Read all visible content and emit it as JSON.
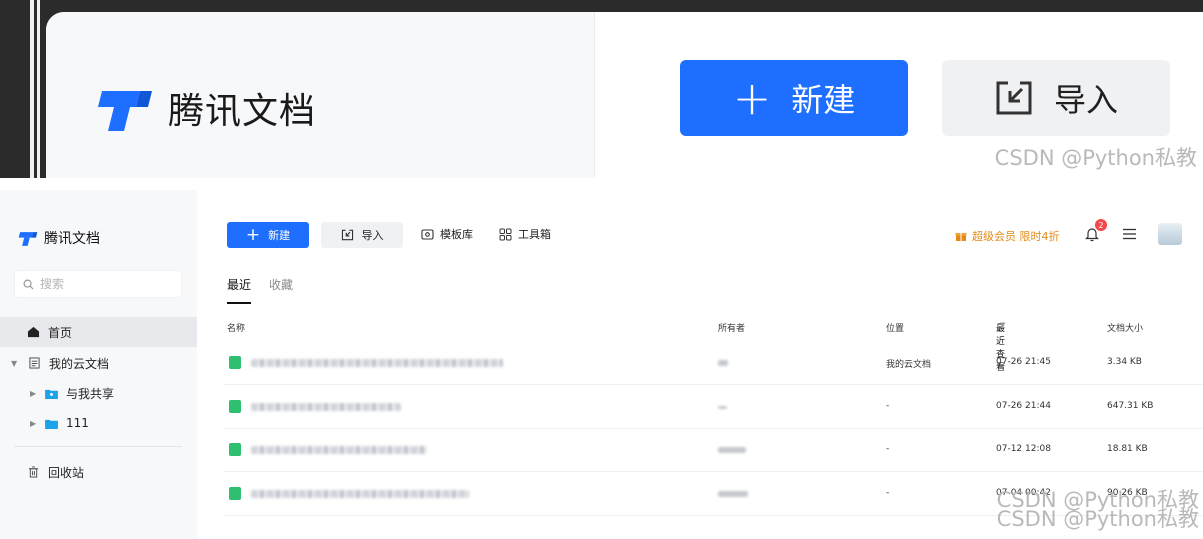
{
  "zoom": {
    "logo_text": "腾讯文档",
    "new_button_label": "新建",
    "import_button_label": "导入",
    "watermark": "CSDN @Python私教"
  },
  "sidebar": {
    "logo_text": "腾讯文档",
    "search_placeholder": "搜索",
    "items": [
      {
        "label": "首页",
        "icon": "home-icon",
        "active": true
      },
      {
        "label": "我的云文档",
        "icon": "doc-icon"
      },
      {
        "label": "与我共享",
        "icon": "shared-folder-icon"
      },
      {
        "label": "111",
        "icon": "folder-icon"
      },
      {
        "label": "回收站",
        "icon": "trash-icon"
      }
    ]
  },
  "toolbar": {
    "new_label": "新建",
    "import_label": "导入",
    "templates_label": "模板库",
    "toolbox_label": "工具箱",
    "vip_label": "超级会员 限时4折",
    "notification_count": "2"
  },
  "tabs": [
    {
      "label": "最近",
      "active": true
    },
    {
      "label": "收藏",
      "active": false
    }
  ],
  "table": {
    "headers": {
      "name": "名称",
      "owner": "所有者",
      "location": "位置",
      "last_viewed": "最近查看",
      "size": "文档大小"
    },
    "rows": [
      {
        "location": "我的云文档",
        "last_viewed": "07-26 21:45",
        "size": "3.34 KB"
      },
      {
        "location": "-",
        "last_viewed": "07-26 21:44",
        "size": "647.31 KB"
      },
      {
        "location": "-",
        "last_viewed": "07-12 12:08",
        "size": "18.81 KB"
      },
      {
        "location": "-",
        "last_viewed": "07-04 00:42",
        "size": "90.26 KB"
      }
    ]
  },
  "watermark": "CSDN @Python私教",
  "colors": {
    "primary": "#1e6fff",
    "vip": "#e38a17",
    "badge": "#f5484a",
    "sheet_icon": "#2fbf71"
  }
}
